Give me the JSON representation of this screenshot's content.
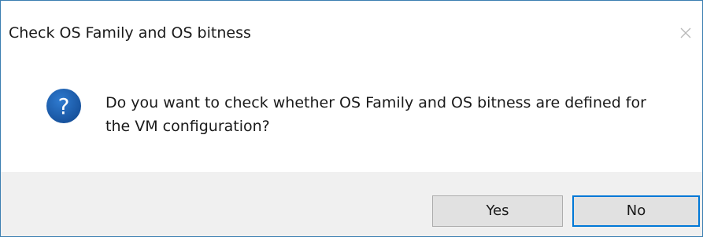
{
  "dialog": {
    "title": "Check OS Family and OS bitness",
    "close_icon": "close-icon",
    "icon": "question-icon",
    "message": "Do you want to check whether OS Family and OS bitness are defined for the VM configuration?",
    "buttons": {
      "yes_label": "Yes",
      "no_label": "No"
    }
  },
  "colors": {
    "icon_blue": "#1c5fa8",
    "focus_border": "#0078d7",
    "footer_bg": "#f0f0f0"
  }
}
